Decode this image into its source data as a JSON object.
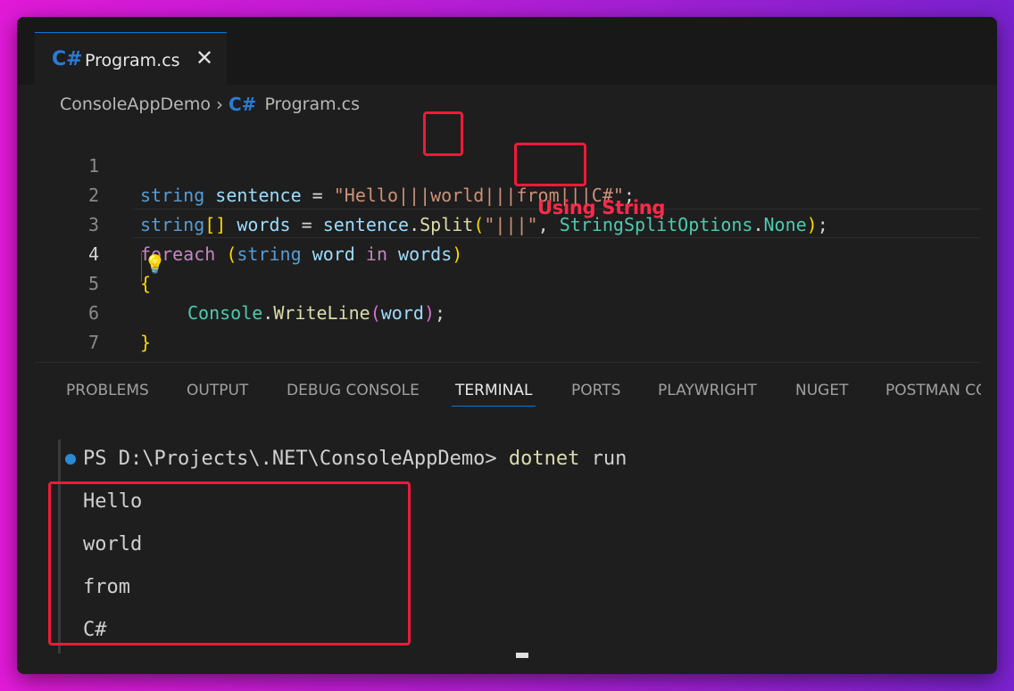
{
  "tab": {
    "icon": "csharp-icon",
    "icon_text": "C#",
    "label": "Program.cs",
    "close": "✕"
  },
  "breadcrumb": {
    "folder": "ConsoleAppDemo",
    "separator": "›",
    "icon_text": "C#",
    "file": "Program.cs"
  },
  "code": {
    "line_numbers": [
      "1",
      "2",
      "3",
      "4",
      "5",
      "6",
      "7"
    ],
    "line1": {
      "kw": "string",
      "var": "sentence",
      "eq": "=",
      "str": "\"Hello|||world|||from|||C#\"",
      "semi": ";"
    },
    "line2": {
      "kw": "string",
      "br": "[]",
      "var": "words",
      "eq": "=",
      "obj": "sentence",
      "dot": ".",
      "fn": "Split",
      "open": "(",
      "str": "\"|||\"",
      "comma": ",",
      "type": "StringSplitOptions",
      "dot2": ".",
      "member": "None",
      "close": ")",
      "semi": ";"
    },
    "line3": {
      "kw": "foreach",
      "open": "(",
      "kw2": "string",
      "var": "word",
      "kw3": "in",
      "var2": "words",
      "close": ")"
    },
    "line4": {
      "brace": "{"
    },
    "line5": {
      "type": "Console",
      "dot": ".",
      "fn": "WriteLine",
      "open": "(",
      "var": "word",
      "close": ")",
      "semi": ";"
    },
    "line6": {
      "brace": "}"
    }
  },
  "annotation": "Using String",
  "panel": {
    "tabs": [
      "PROBLEMS",
      "OUTPUT",
      "DEBUG CONSOLE",
      "TERMINAL",
      "PORTS",
      "PLAYWRIGHT",
      "NUGET",
      "POSTMAN CONSOLE"
    ],
    "active_tab": "TERMINAL"
  },
  "terminal": {
    "prompt": "PS D:\\Projects\\.NET\\ConsoleAppDemo>",
    "command": "dotnet",
    "arg": "run",
    "output": [
      "Hello",
      "world",
      "from",
      "C#"
    ]
  },
  "colors": {
    "accent": "#0a78d4",
    "highlight": "#f0193a",
    "keyword": "#569cd6",
    "string": "#ce9178"
  }
}
